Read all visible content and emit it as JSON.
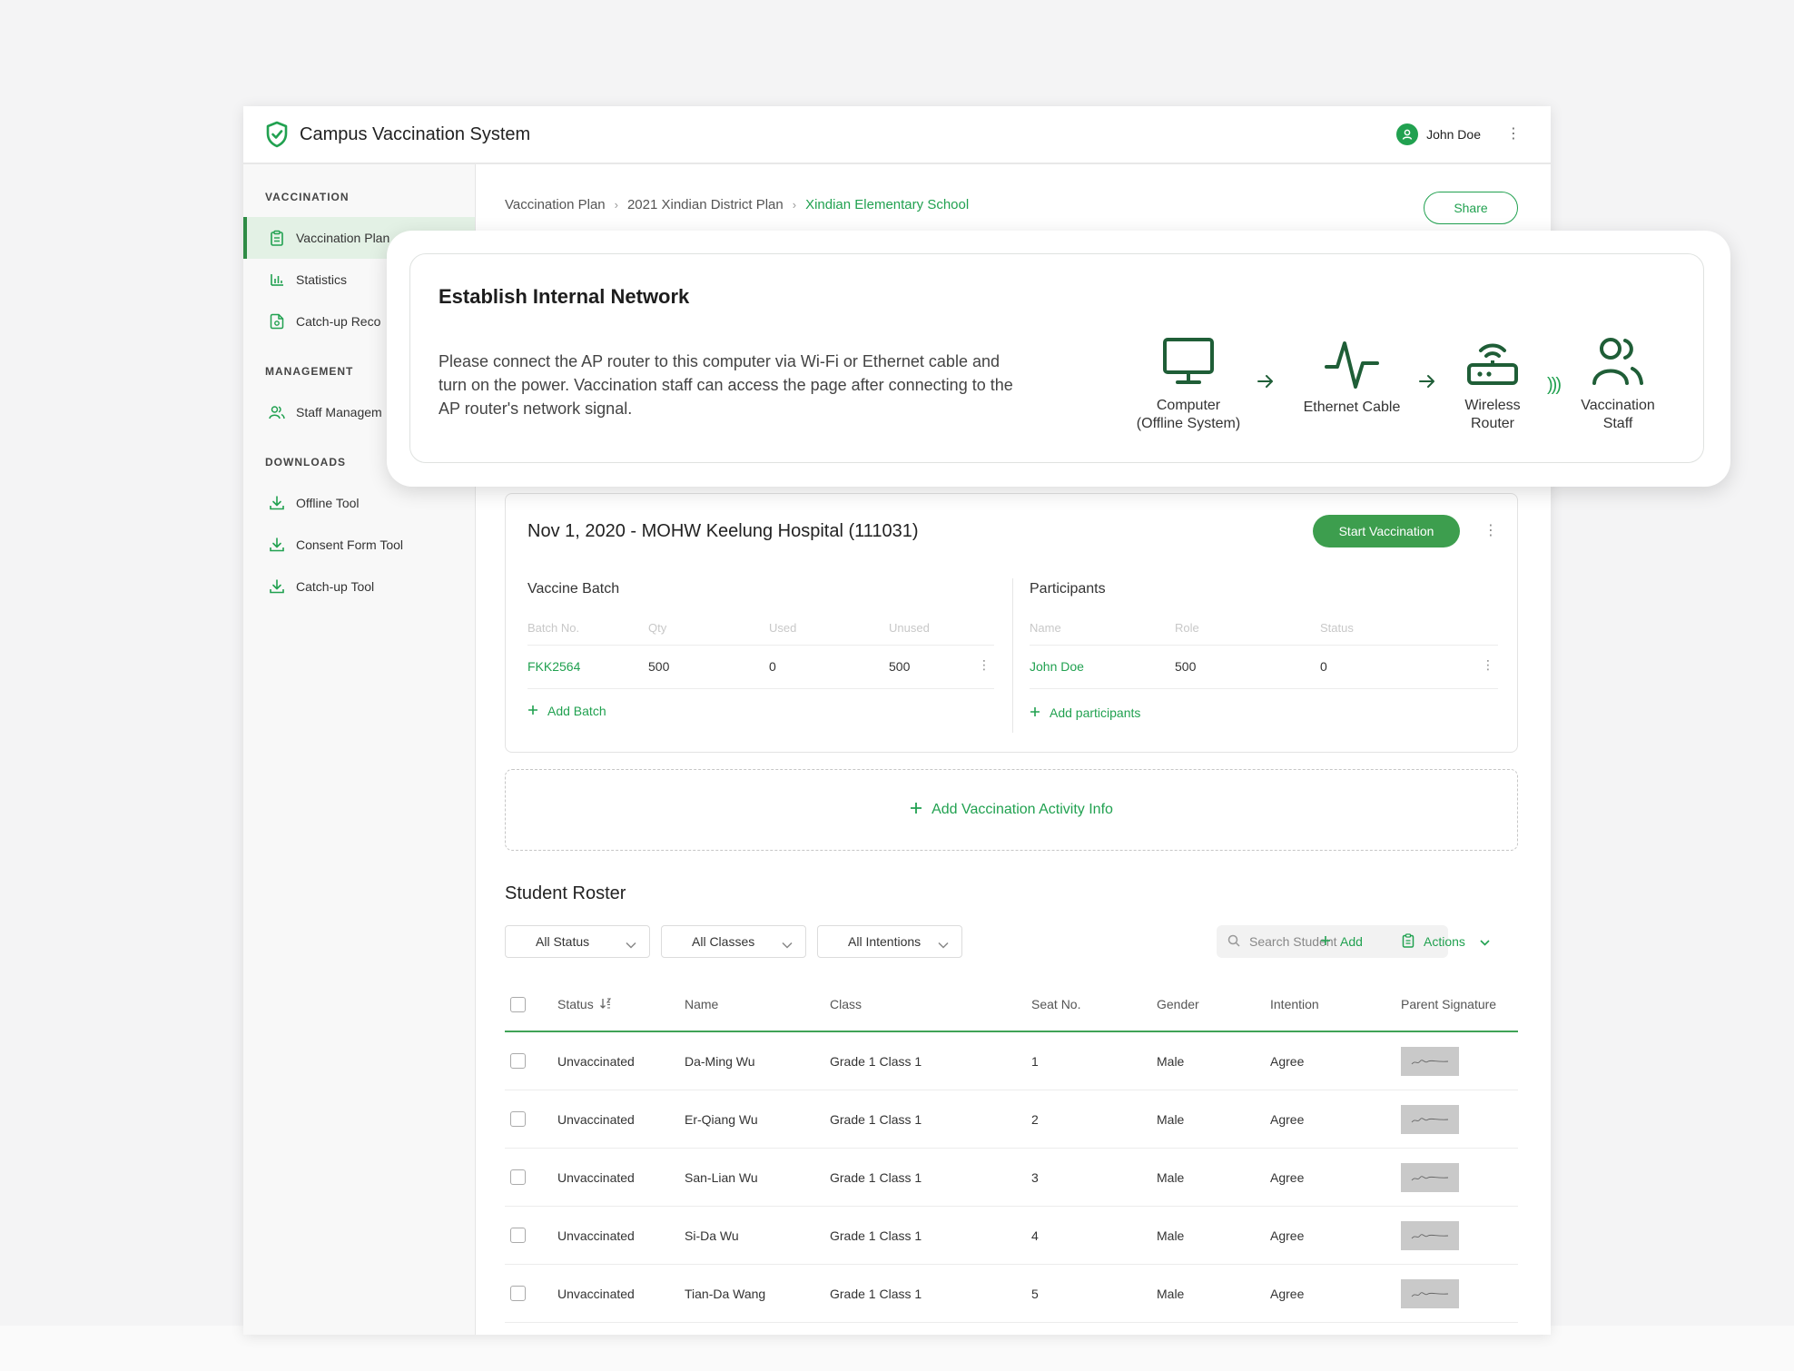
{
  "app": {
    "title": "Campus Vaccination System",
    "user_name": "John Doe"
  },
  "sidebar": {
    "sections": [
      {
        "title": "VACCINATION",
        "items": [
          {
            "label": "Vaccination Plan",
            "icon": "clipboard-icon",
            "active": true
          },
          {
            "label": "Statistics",
            "icon": "bar-chart-icon",
            "active": false
          },
          {
            "label": "Catch-up Reco",
            "icon": "file-search-icon",
            "active": false
          }
        ]
      },
      {
        "title": "MANAGEMENT",
        "items": [
          {
            "label": "Staff Managem",
            "icon": "users-icon",
            "active": false
          }
        ]
      },
      {
        "title": "DOWNLOADS",
        "items": [
          {
            "label": "Offline Tool",
            "icon": "download-icon",
            "active": false
          },
          {
            "label": "Consent Form Tool",
            "icon": "download-icon",
            "active": false
          },
          {
            "label": "Catch-up Tool",
            "icon": "download-icon",
            "active": false
          }
        ]
      }
    ]
  },
  "breadcrumb": {
    "items": [
      "Vaccination Plan",
      "2021 Xindian District Plan"
    ],
    "current": "Xindian Elementary School"
  },
  "share_label": "Share",
  "popup": {
    "title": "Establish Internal Network",
    "body": "Please connect the AP router to this computer via Wi-Fi or Ethernet cable and turn on the power. Vaccination staff can access the page after connecting to the AP router's network signal.",
    "flow": [
      {
        "line1": "Computer",
        "line2": "(Offline System)"
      },
      {
        "line1": "Ethernet Cable",
        "line2": ""
      },
      {
        "line1": "Wireless",
        "line2": "Router"
      },
      {
        "line1": "Vaccination",
        "line2": "Staff"
      }
    ],
    "waves": ")))"
  },
  "activity": {
    "title": "Nov 1, 2020 - MOHW Keelung Hospital (111031)",
    "start_label": "Start Vaccination",
    "batch": {
      "title": "Vaccine Batch",
      "headers": [
        "Batch No.",
        "Qty",
        "Used",
        "Unused"
      ],
      "rows": [
        {
          "batch_no": "FKK2564",
          "qty": "500",
          "used": "0",
          "unused": "500"
        }
      ],
      "add_label": "Add Batch"
    },
    "participants": {
      "title": "Participants",
      "headers": [
        "Name",
        "Role",
        "Status"
      ],
      "rows": [
        {
          "name": "John Doe",
          "role": "500",
          "status": "0"
        }
      ],
      "add_label": "Add participants"
    }
  },
  "add_activity_label": "Add Vaccination Activity Info",
  "roster": {
    "title": "Student Roster",
    "filters": [
      "All Status",
      "All Classes",
      "All Intentions"
    ],
    "search_placeholder": "Search Student",
    "add_label": "Add",
    "actions_label": "Actions",
    "headers": {
      "status": "Status",
      "name": "Name",
      "class": "Class",
      "seat": "Seat No.",
      "gender": "Gender",
      "intention": "Intention",
      "signature": "Parent Signature"
    },
    "rows": [
      {
        "status": "Unvaccinated",
        "name": "Da-Ming Wu",
        "class": "Grade 1 Class 1",
        "seat": "1",
        "gender": "Male",
        "intention": "Agree"
      },
      {
        "status": "Unvaccinated",
        "name": "Er-Qiang Wu",
        "class": "Grade 1 Class 1",
        "seat": "2",
        "gender": "Male",
        "intention": "Agree"
      },
      {
        "status": "Unvaccinated",
        "name": "San-Lian Wu",
        "class": "Grade 1 Class 1",
        "seat": "3",
        "gender": "Male",
        "intention": "Agree"
      },
      {
        "status": "Unvaccinated",
        "name": "Si-Da Wu",
        "class": "Grade 1 Class 1",
        "seat": "4",
        "gender": "Male",
        "intention": "Agree"
      },
      {
        "status": "Unvaccinated",
        "name": "Tian-Da Wang",
        "class": "Grade 1 Class 1",
        "seat": "5",
        "gender": "Male",
        "intention": "Agree"
      }
    ]
  },
  "colors": {
    "accent": "#21a150",
    "button": "#3d9e4e",
    "icon_dark": "#1f5e37",
    "active_bg": "#e3f1e5"
  }
}
